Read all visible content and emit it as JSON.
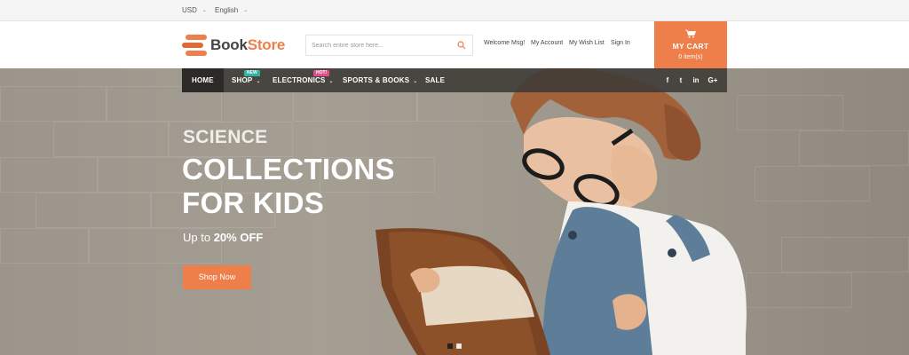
{
  "topbar": {
    "currency": "USD",
    "language": "English"
  },
  "header": {
    "logo_part1": "Book",
    "logo_part2": "Store",
    "search_placeholder": "Search entire store here...",
    "links": [
      "Welcome Msg!",
      "My Account",
      "My Wish List",
      "Sign In"
    ],
    "cart_label": "MY CART",
    "cart_count": "0 item(s)"
  },
  "nav": {
    "items": [
      {
        "label": "HOME"
      },
      {
        "label": "SHOP",
        "badge": "NEW"
      },
      {
        "label": "ELECTRONICS",
        "badge": "HOT!"
      },
      {
        "label": "SPORTS & BOOKS"
      },
      {
        "label": "SALE"
      }
    ],
    "social": [
      "f",
      "t",
      "in",
      "G+"
    ]
  },
  "hero": {
    "subtitle": "SCIENCE",
    "title_line1": "COLLECTIONS",
    "title_line2": "FOR KIDS",
    "offer_prefix": "Up to",
    "offer_value": "20% OFF",
    "button_label": "Shop Now"
  },
  "colors": {
    "accent": "#ef7f4a",
    "nav_bg": "#3c3a36",
    "badge_new": "#2bb5a5",
    "badge_hot": "#e04f8a"
  },
  "icons": [
    "chevron-down-icon",
    "search-icon",
    "cart-icon",
    "facebook-icon",
    "twitter-icon",
    "linkedin-icon",
    "google-plus-icon"
  ]
}
